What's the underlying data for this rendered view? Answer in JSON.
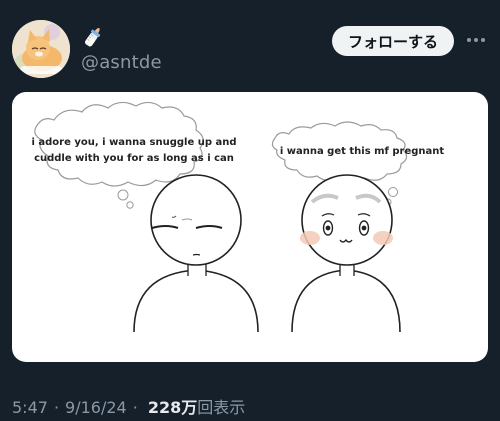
{
  "author": {
    "handle": "@asntde",
    "avatar_icon": "cat-avatar",
    "name_icon": "baby-bottle-icon"
  },
  "actions": {
    "follow_label": "フォローする",
    "more_icon": "more-icon"
  },
  "media": {
    "left_thought": {
      "line1": "i adore you, i wanna snuggle up and",
      "line2": "cuddle with you for as long as i can"
    },
    "right_thought": {
      "line1": "i wanna get this mf pregnant"
    }
  },
  "meta": {
    "time": "5:47",
    "separator": "·",
    "date": "9/16/24",
    "views_count": "228",
    "views_unit": "万",
    "views_label": "回表示"
  },
  "colors": {
    "background": "#15202b",
    "secondary_text": "#8b98a5",
    "button_bg": "#eff3f4",
    "blush": "#f2c9b6"
  }
}
